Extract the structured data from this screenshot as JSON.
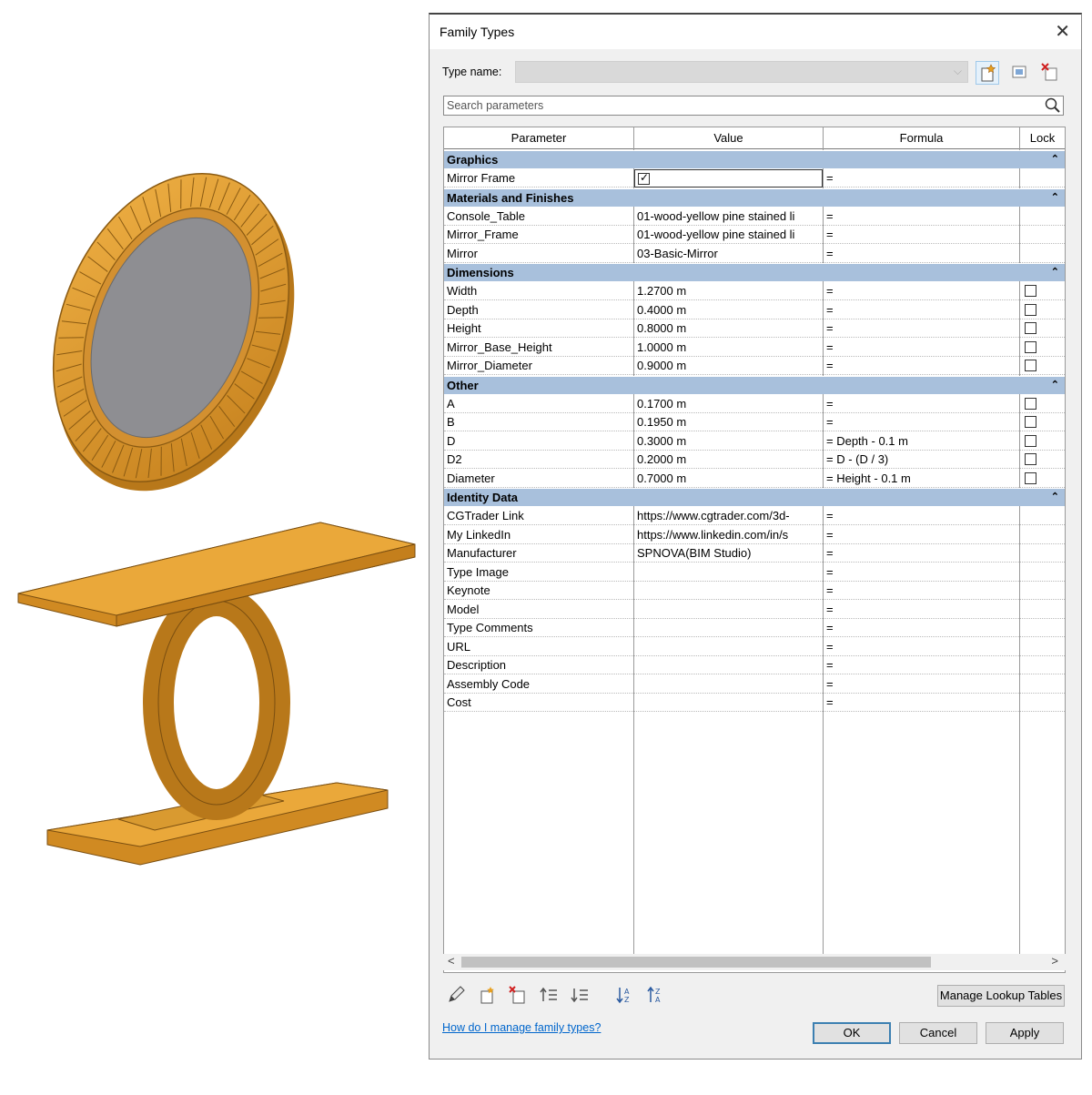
{
  "dialog": {
    "title": "Family Types",
    "type_name_label": "Type name:",
    "type_name_value": "",
    "search_placeholder": "Search parameters",
    "columns": [
      "Parameter",
      "Value",
      "Formula",
      "Lock"
    ],
    "groups": [
      {
        "name": "Graphics",
        "rows": [
          {
            "param": "Mirror Frame",
            "value": "",
            "checkbox_value": true,
            "formula": "=",
            "lock": null
          }
        ]
      },
      {
        "name": "Materials and Finishes",
        "rows": [
          {
            "param": "Console_Table",
            "value": "01-wood-yellow pine stained li",
            "formula": "=",
            "lock": null
          },
          {
            "param": "Mirror_Frame",
            "value": "01-wood-yellow pine stained li",
            "formula": "=",
            "lock": null
          },
          {
            "param": "Mirror",
            "value": "03-Basic-Mirror",
            "formula": "=",
            "lock": null
          }
        ]
      },
      {
        "name": "Dimensions",
        "rows": [
          {
            "param": "Width",
            "value": "1.2700 m",
            "formula": "=",
            "lock": false
          },
          {
            "param": "Depth",
            "value": "0.4000 m",
            "formula": "=",
            "lock": false
          },
          {
            "param": "Height",
            "value": "0.8000 m",
            "formula": "=",
            "lock": false
          },
          {
            "param": "Mirror_Base_Height",
            "value": "1.0000 m",
            "formula": "=",
            "lock": false
          },
          {
            "param": "Mirror_Diameter",
            "value": "0.9000 m",
            "formula": "=",
            "lock": false
          }
        ]
      },
      {
        "name": "Other",
        "rows": [
          {
            "param": "A",
            "value": "0.1700 m",
            "formula": "=",
            "lock": false
          },
          {
            "param": "B",
            "value": "0.1950 m",
            "formula": "=",
            "lock": false
          },
          {
            "param": "D",
            "value": "0.3000 m",
            "formula": "= Depth - 0.1 m",
            "lock": false
          },
          {
            "param": "D2",
            "value": "0.2000 m",
            "formula": "= D - (D / 3)",
            "lock": false
          },
          {
            "param": "Diameter",
            "value": "0.7000 m",
            "formula": "= Height - 0.1 m",
            "lock": false
          }
        ]
      },
      {
        "name": "Identity Data",
        "rows": [
          {
            "param": "CGTrader Link",
            "value": "https://www.cgtrader.com/3d-",
            "formula": "=",
            "lock": null
          },
          {
            "param": "My LinkedIn",
            "value": "https://www.linkedin.com/in/s",
            "formula": "=",
            "lock": null
          },
          {
            "param": "Manufacturer",
            "value": "SPNOVA(BIM Studio)",
            "formula": "=",
            "lock": null
          },
          {
            "param": "Type Image",
            "value": "",
            "formula": "=",
            "lock": null
          },
          {
            "param": "Keynote",
            "value": "",
            "formula": "=",
            "lock": null
          },
          {
            "param": "Model",
            "value": "",
            "formula": "=",
            "lock": null
          },
          {
            "param": "Type Comments",
            "value": "",
            "formula": "=",
            "lock": null
          },
          {
            "param": "URL",
            "value": "",
            "formula": "=",
            "lock": null
          },
          {
            "param": "Description",
            "value": "",
            "formula": "=",
            "lock": null
          },
          {
            "param": "Assembly Code",
            "value": "",
            "formula": "=",
            "lock": null
          },
          {
            "param": "Cost",
            "value": "",
            "formula": "=",
            "lock": null
          }
        ]
      }
    ],
    "manage_lookup_label": "Manage Lookup Tables",
    "help_link": "How do I manage family types?",
    "ok_label": "OK",
    "cancel_label": "Cancel",
    "apply_label": "Apply"
  },
  "colors": {
    "group_header": "#a8c0dc",
    "model_gold": "#d9962a",
    "mirror_glass": "#8e8e92"
  },
  "icons": [
    "close-icon",
    "new-type-icon",
    "rename-type-icon",
    "delete-type-icon",
    "search-icon",
    "pencil-icon",
    "new-parameter-icon",
    "delete-parameter-icon",
    "move-up-icon",
    "move-down-icon",
    "sort-ascending-icon",
    "sort-descending-icon"
  ]
}
